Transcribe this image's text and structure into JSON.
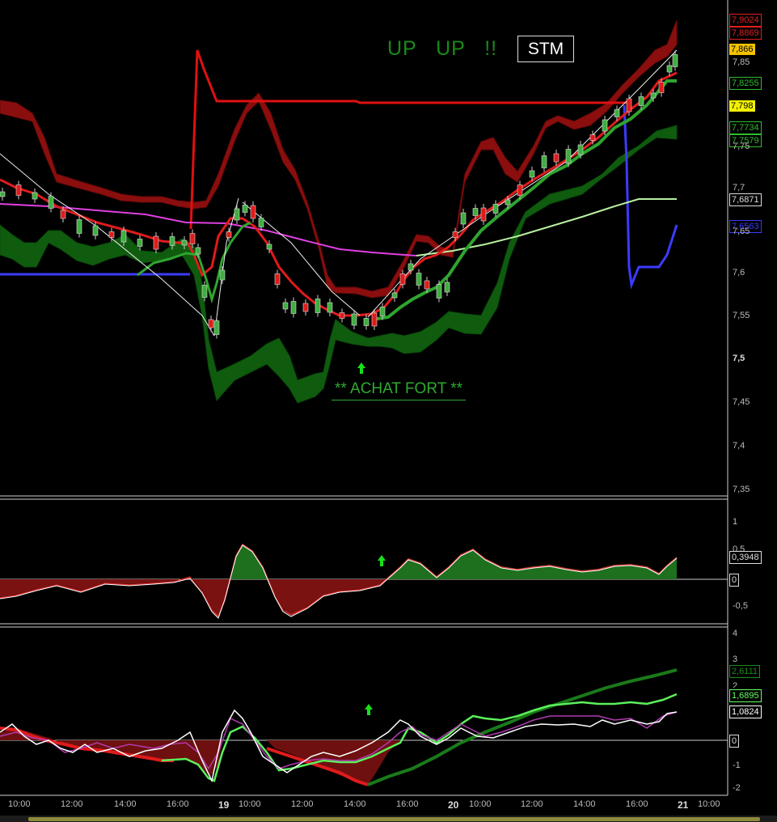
{
  "annotations": {
    "signal_text": "UP   UP   !!",
    "ticker": "STM",
    "buy_text": "** ACHAT FORT **"
  },
  "chart_data": [
    {
      "type": "line",
      "panel": "price",
      "yticks": [
        "7,85",
        "7,75",
        "7,7",
        "7,65",
        "7,6",
        "7,55",
        "7,5",
        "7,45",
        "7,4",
        "7,35"
      ],
      "ylim": [
        7.33,
        7.92
      ],
      "price_tags": [
        {
          "label": "7,9024",
          "color": "#e02020",
          "bg": "#000"
        },
        {
          "label": "7,8869",
          "color": "#e02020",
          "bg": "#000"
        },
        {
          "label": "7,866",
          "color": "#000",
          "bg": "#f2c200"
        },
        {
          "label": "7,8255",
          "color": "#2fbf2f",
          "bg": "#000"
        },
        {
          "label": "7,798",
          "color": "#000",
          "bg": "#f2f200"
        },
        {
          "label": "7,7734",
          "color": "#2fbf2f",
          "bg": "#000"
        },
        {
          "label": "7,7579",
          "color": "#2fbf2f",
          "bg": "#000"
        },
        {
          "label": "7,6871",
          "color": "#ddd",
          "bg": "#000"
        },
        {
          "label": "7,6563",
          "color": "#3b3bff",
          "bg": "#000"
        }
      ]
    },
    {
      "type": "area",
      "panel": "oscillator",
      "yticks": [
        "1",
        "0,5",
        "0",
        "-0,5"
      ],
      "ylim": [
        -0.85,
        1.05
      ],
      "last_value": "0,3948",
      "zero_label": "0"
    },
    {
      "type": "line",
      "panel": "momentum",
      "yticks": [
        "4",
        "3",
        "2",
        "1",
        "0",
        "-1",
        "-2"
      ],
      "ylim": [
        -2.1,
        4.1
      ],
      "last_values": [
        {
          "label": "2,6111",
          "color": "#1a8a1a"
        },
        {
          "label": "1,6895",
          "color": "#6f6"
        },
        {
          "label": "1,0824",
          "color": "#fff"
        }
      ],
      "zero_label": "0"
    }
  ],
  "x_axis": {
    "ticks": [
      "10:00",
      "12:00",
      "14:00",
      "16:00",
      "19",
      "10:00",
      "12:00",
      "14:00",
      "16:00",
      "20",
      "10:00",
      "12:00",
      "14:00",
      "16:00",
      "21",
      "10:00"
    ]
  },
  "colors": {
    "bull_candle": "#3fae3f",
    "bear_candle": "#e01b1b",
    "upper_band": "#8b0e0e",
    "lower_band": "#0f5c0f",
    "ma_magenta": "#e040e0",
    "ma_lightgreen": "#b8f0a0",
    "blue_line": "#3b3bff"
  }
}
